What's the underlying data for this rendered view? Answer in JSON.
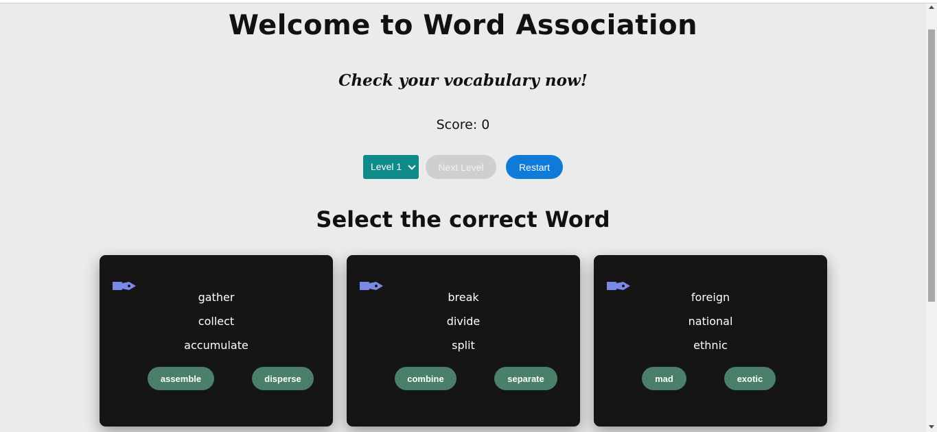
{
  "header": {
    "title": "Welcome to Word Association",
    "subtitle": "Check your vocabulary now!",
    "score_text": "Score: 0"
  },
  "controls": {
    "level_selected": "Level 1",
    "next_label": "Next Level",
    "restart_label": "Restart"
  },
  "section": {
    "title": "Select the correct Word"
  },
  "colors": {
    "background": "#ebebeb",
    "card": "#151515",
    "option_button": "#4a7f6a",
    "level_select": "#0e8a8a",
    "restart_button": "#0f7ad8",
    "next_button_disabled": "#cfcfcf",
    "speaker_icon": "#7b8ae6"
  },
  "cards": [
    {
      "icon": "speaker-icon",
      "words": [
        "gather",
        "collect",
        "accumulate"
      ],
      "options": [
        "assemble",
        "disperse"
      ]
    },
    {
      "icon": "speaker-icon",
      "words": [
        "break",
        "divide",
        "split"
      ],
      "options": [
        "combine",
        "separate"
      ]
    },
    {
      "icon": "speaker-icon",
      "words": [
        "foreign",
        "national",
        "ethnic"
      ],
      "options": [
        "mad",
        "exotic"
      ]
    }
  ]
}
